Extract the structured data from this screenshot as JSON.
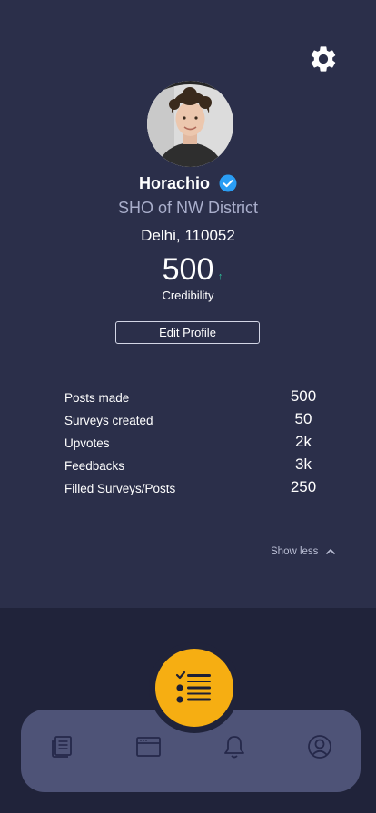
{
  "profile": {
    "name": "Horachio",
    "role": "SHO of NW District",
    "location": "Delhi, 110052",
    "credibility_value": "500",
    "credibility_trend": "↑",
    "credibility_label": "Credibility",
    "verified": true
  },
  "actions": {
    "edit_profile_label": "Edit Profile",
    "show_less_label": "Show less"
  },
  "stats": [
    {
      "label": "Posts made",
      "value": "500"
    },
    {
      "label": "Surveys created",
      "value": "50"
    },
    {
      "label": "Upvotes",
      "value": "2k"
    },
    {
      "label": "Feedbacks",
      "value": "3k"
    },
    {
      "label": "Filled Surveys/Posts",
      "value": "250"
    }
  ],
  "nav": {
    "items": [
      "news-icon",
      "browser-icon",
      "bell-icon",
      "user-icon"
    ],
    "center_action": "checklist-icon"
  },
  "colors": {
    "background": "#20233a",
    "card": "#2b2f4a",
    "nav_bar": "#4e5377",
    "accent": "#f6ae12",
    "verified_badge": "#2a9df4",
    "trend_up": "#2ec29a"
  }
}
